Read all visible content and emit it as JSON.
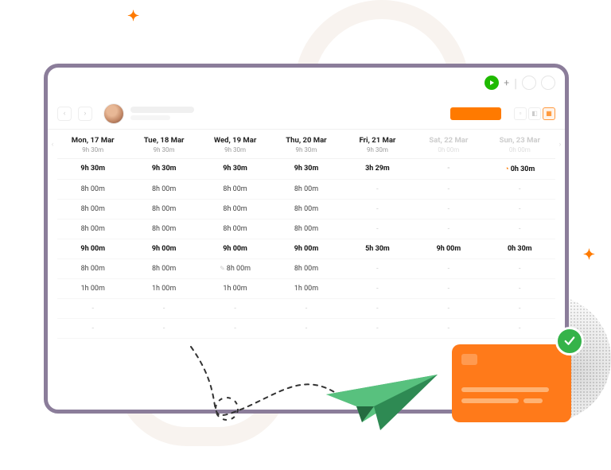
{
  "colors": {
    "accent": "#ff7a00",
    "play": "#1fba00",
    "ok": "#35b34a"
  },
  "icons": {
    "chev_left": "‹",
    "chev_right": "›",
    "plus": "+",
    "pipe": "|",
    "warn": "◔",
    "pencil": "✎",
    "check": "✓"
  },
  "columns": [
    {
      "label": "Mon, 17 Mar",
      "total": "9h 30m",
      "off": false
    },
    {
      "label": "Tue, 18 Mar",
      "total": "9h 30m",
      "off": false
    },
    {
      "label": "Wed, 19 Mar",
      "total": "9h 30m",
      "off": false
    },
    {
      "label": "Thu, 20 Mar",
      "total": "9h 30m",
      "off": false
    },
    {
      "label": "Fri, 21 Mar",
      "total": "9h 30m",
      "off": false
    },
    {
      "label": "Sat, 22 Mar",
      "total": "0h 00m",
      "off": true
    },
    {
      "label": "Sun, 23 Mar",
      "total": "0h 00m",
      "off": true
    }
  ],
  "rows": [
    {
      "bold": true,
      "cells": [
        "9h 30m",
        "9h 30m",
        "9h 30m",
        "9h 30m",
        "3h 29m",
        "-",
        "0h 30m"
      ],
      "flags": {
        "6": "warn"
      }
    },
    {
      "bold": false,
      "cells": [
        "8h 00m",
        "8h 00m",
        "8h 00m",
        "8h 00m",
        "-",
        "-",
        "-"
      ]
    },
    {
      "bold": false,
      "cells": [
        "8h 00m",
        "8h 00m",
        "8h 00m",
        "8h 00m",
        "-",
        "-",
        "-"
      ]
    },
    {
      "bold": false,
      "cells": [
        "8h 00m",
        "8h 00m",
        "8h 00m",
        "8h 00m",
        "-",
        "-",
        "-"
      ]
    },
    {
      "bold": true,
      "cells": [
        "9h 00m",
        "9h 00m",
        "9h 00m",
        "9h 00m",
        "5h 30m",
        "9h 00m",
        "0h 30m"
      ]
    },
    {
      "bold": false,
      "cells": [
        "8h 00m",
        "8h 00m",
        "8h 00m",
        "8h 00m",
        "-",
        "-",
        "-"
      ],
      "flags": {
        "2": "pencil"
      }
    },
    {
      "bold": false,
      "cells": [
        "1h 00m",
        "1h 00m",
        "1h 00m",
        "1h 00m",
        "-",
        "-",
        "-"
      ]
    },
    {
      "bold": false,
      "cells": [
        "-",
        "-",
        "-",
        "-",
        "-",
        "-",
        "-"
      ]
    },
    {
      "bold": false,
      "cells": [
        "-",
        "-",
        "-",
        "-",
        "-",
        "-",
        "-"
      ]
    }
  ]
}
